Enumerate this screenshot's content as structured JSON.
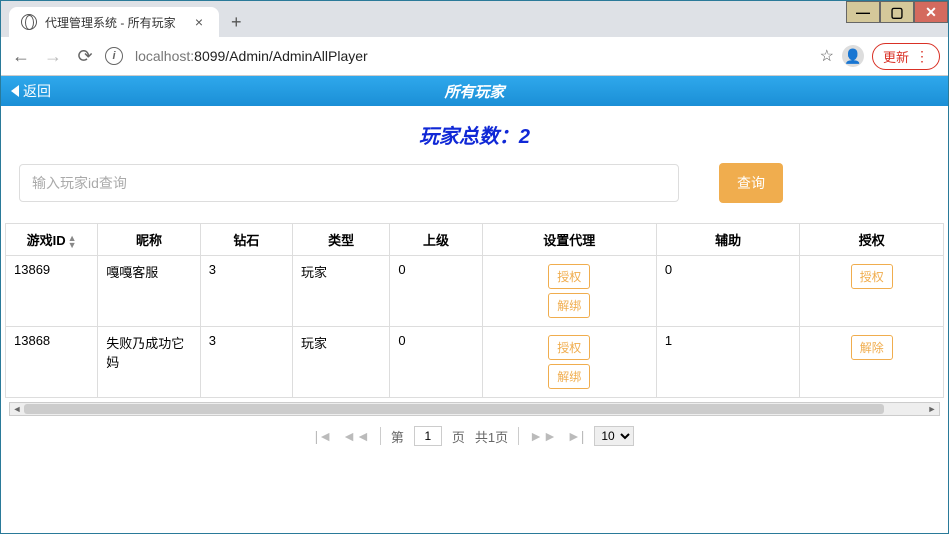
{
  "browser": {
    "tab_title": "代理管理系统 - 所有玩家",
    "url_host": "localhost:",
    "url_port_path": "8099/Admin/AdminAllPlayer",
    "update_label": "更新"
  },
  "header": {
    "back_label": "返回",
    "page_title": "所有玩家"
  },
  "subtitle": "玩家总数：2",
  "search": {
    "placeholder": "输入玩家id查询",
    "query_label": "查询"
  },
  "table": {
    "columns": {
      "game_id": "游戏ID",
      "nickname": "昵称",
      "diamond": "钻石",
      "type": "类型",
      "superior": "上级",
      "set_agent": "设置代理",
      "assist": "辅助",
      "authorize": "授权"
    },
    "rows": [
      {
        "game_id": "13869",
        "nickname": "嘎嘎客服",
        "diamond": "3",
        "type": "玩家",
        "superior": "0",
        "agent_actions": [
          "授权",
          "解绑"
        ],
        "assist": "0",
        "auth_actions": [
          "授权"
        ]
      },
      {
        "game_id": "13868",
        "nickname": "失败乃成功它妈",
        "diamond": "3",
        "type": "玩家",
        "superior": "0",
        "agent_actions": [
          "授权",
          "解绑"
        ],
        "assist": "1",
        "auth_actions": [
          "解除"
        ]
      }
    ]
  },
  "pager": {
    "page_label_prefix": "第",
    "page_value": "1",
    "page_label_suffix": "页",
    "total_label": "共1页",
    "page_size": "10"
  }
}
